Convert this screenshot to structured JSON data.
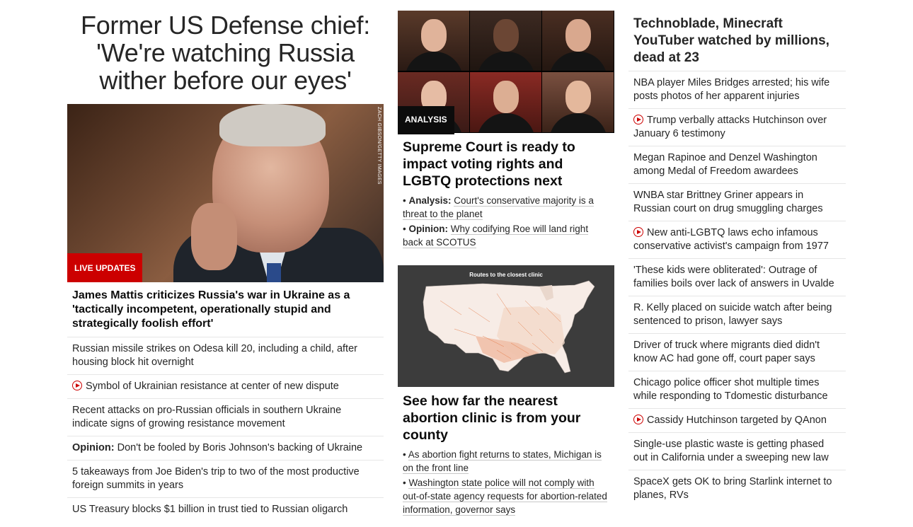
{
  "main": {
    "headline": "Former US Defense chief: 'We're watching Russia wither before our eyes'",
    "photo_credit": "ZACH GIBSON/GETTY IMAGES",
    "badge": "LIVE UPDATES",
    "lead": "James Mattis criticizes Russia's war in Ukraine as a 'tactically incompetent, operationally stupid and strategically foolish effort'",
    "items": [
      {
        "text": "Russian missile strikes on Odesa kill 20, including a child, after housing block hit overnight"
      },
      {
        "text": "Symbol of Ukrainian resistance at center of new dispute",
        "video": true
      },
      {
        "text": "Recent attacks on pro-Russian officials in southern Ukraine indicate signs of growing resistance movement"
      },
      {
        "prefix": "Opinion:",
        "text": " Don't be fooled by Boris Johnson's backing of Ukraine"
      },
      {
        "text": "5 takeaways from Joe Biden's trip to two of the most productive foreign summits in years"
      },
      {
        "text": "US Treasury blocks $1 billion in trust tied to Russian oligarch"
      }
    ]
  },
  "scotus": {
    "badge": "ANALYSIS",
    "headline": "Supreme Court is ready to impact voting rights and LGBTQ protections next",
    "subs": [
      {
        "prefix": "Analysis:",
        "text": "Court's conservative majority is a threat to the planet"
      },
      {
        "prefix": "Opinion:",
        "text": "Why codifying Roe will land right back at SCOTUS"
      }
    ]
  },
  "clinic": {
    "map_caption": "Routes to the closest clinic",
    "headline": "See how far the nearest abortion clinic is from your county",
    "subs": [
      {
        "text": "As abortion fight returns to states, Michigan is on the front line"
      },
      {
        "text": "Washington state police will not comply with out-of-state agency requests for abortion-related information, governor says"
      }
    ]
  },
  "right": {
    "top": "Technoblade, Minecraft YouTuber watched by millions, dead at 23",
    "items": [
      {
        "text": "NBA player Miles Bridges arrested; his wife posts photos of her apparent injuries"
      },
      {
        "text": "Trump verbally attacks Hutchinson over January 6 testimony",
        "video": true
      },
      {
        "text": "Megan Rapinoe and Denzel Washington among Medal of Freedom awardees"
      },
      {
        "text": "WNBA star Brittney Griner appears in Russian court on drug smuggling charges"
      },
      {
        "text": "New anti-LGBTQ laws echo infamous conservative activist's campaign from 1977",
        "video": true
      },
      {
        "text": "'These kids were obliterated': Outrage of families boils over lack of answers in Uvalde"
      },
      {
        "text": "R. Kelly placed on suicide watch after being sentenced to prison, lawyer says"
      },
      {
        "text": "Driver of truck where migrants died didn't know AC had gone off, court paper says"
      },
      {
        "text": "Chicago police officer shot multiple times while responding to Tdomestic disturbance"
      },
      {
        "text": "Cassidy Hutchinson targeted by QAnon",
        "video": true
      },
      {
        "text": "Single-use plastic waste is getting phased out in California under a sweeping new law"
      },
      {
        "text": "SpaceX gets OK to bring Starlink internet to planes, RVs"
      }
    ]
  },
  "colors": {
    "accent_red": "#cc0000",
    "text": "#262626",
    "badge_dark": "#0c0c0c",
    "map_bg": "#3c3c3c"
  }
}
